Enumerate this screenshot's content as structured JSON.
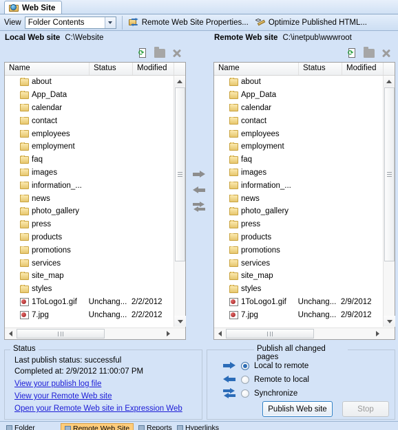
{
  "document_tab": {
    "label": "Web Site",
    "icon": "web-site-icon"
  },
  "toolbar": {
    "view_label": "View",
    "view_value": "Folder Contents",
    "remote_properties_label": "Remote Web Site Properties...",
    "optimize_label": "Optimize Published HTML..."
  },
  "local": {
    "title": "Local Web site",
    "path": "C:\\Website",
    "tools": [
      "refresh-icon",
      "new-folder-icon",
      "delete-icon"
    ],
    "columns": [
      "Name",
      "Status",
      "Modified"
    ],
    "rows": [
      {
        "name": "about",
        "icon": "folder-icon",
        "status": "",
        "modified": ""
      },
      {
        "name": "App_Data",
        "icon": "folder-icon",
        "status": "",
        "modified": ""
      },
      {
        "name": "calendar",
        "icon": "folder-icon",
        "status": "",
        "modified": ""
      },
      {
        "name": "contact",
        "icon": "folder-icon",
        "status": "",
        "modified": ""
      },
      {
        "name": "employees",
        "icon": "folder-icon",
        "status": "",
        "modified": ""
      },
      {
        "name": "employment",
        "icon": "folder-icon",
        "status": "",
        "modified": ""
      },
      {
        "name": "faq",
        "icon": "folder-icon",
        "status": "",
        "modified": ""
      },
      {
        "name": "images",
        "icon": "folder-icon",
        "status": "",
        "modified": ""
      },
      {
        "name": "information_...",
        "icon": "folder-icon",
        "status": "",
        "modified": ""
      },
      {
        "name": "news",
        "icon": "folder-icon",
        "status": "",
        "modified": ""
      },
      {
        "name": "photo_gallery",
        "icon": "folder-icon",
        "status": "",
        "modified": ""
      },
      {
        "name": "press",
        "icon": "folder-icon",
        "status": "",
        "modified": ""
      },
      {
        "name": "products",
        "icon": "folder-icon",
        "status": "",
        "modified": ""
      },
      {
        "name": "promotions",
        "icon": "folder-icon",
        "status": "",
        "modified": ""
      },
      {
        "name": "services",
        "icon": "folder-icon",
        "status": "",
        "modified": ""
      },
      {
        "name": "site_map",
        "icon": "folder-icon",
        "status": "",
        "modified": ""
      },
      {
        "name": "styles",
        "icon": "folder-icon",
        "status": "",
        "modified": ""
      },
      {
        "name": "1ToLogo1.gif",
        "icon": "image-file-icon",
        "status": "Unchang...",
        "modified": "2/2/2012"
      },
      {
        "name": "7.jpg",
        "icon": "image-file-icon",
        "status": "Unchang...",
        "modified": "2/2/2012"
      }
    ]
  },
  "remote": {
    "title": "Remote Web site",
    "path": "C:\\inetpub\\wwwroot",
    "tools": [
      "refresh-icon",
      "new-folder-icon",
      "delete-icon"
    ],
    "columns": [
      "Name",
      "Status",
      "Modified"
    ],
    "rows": [
      {
        "name": "about",
        "icon": "folder-icon",
        "status": "",
        "modified": ""
      },
      {
        "name": "App_Data",
        "icon": "folder-icon",
        "status": "",
        "modified": ""
      },
      {
        "name": "calendar",
        "icon": "folder-icon",
        "status": "",
        "modified": ""
      },
      {
        "name": "contact",
        "icon": "folder-icon",
        "status": "",
        "modified": ""
      },
      {
        "name": "employees",
        "icon": "folder-icon",
        "status": "",
        "modified": ""
      },
      {
        "name": "employment",
        "icon": "folder-icon",
        "status": "",
        "modified": ""
      },
      {
        "name": "faq",
        "icon": "folder-icon",
        "status": "",
        "modified": ""
      },
      {
        "name": "images",
        "icon": "folder-icon",
        "status": "",
        "modified": ""
      },
      {
        "name": "information_...",
        "icon": "folder-icon",
        "status": "",
        "modified": ""
      },
      {
        "name": "news",
        "icon": "folder-icon",
        "status": "",
        "modified": ""
      },
      {
        "name": "photo_gallery",
        "icon": "folder-icon",
        "status": "",
        "modified": ""
      },
      {
        "name": "press",
        "icon": "folder-icon",
        "status": "",
        "modified": ""
      },
      {
        "name": "products",
        "icon": "folder-icon",
        "status": "",
        "modified": ""
      },
      {
        "name": "promotions",
        "icon": "folder-icon",
        "status": "",
        "modified": ""
      },
      {
        "name": "services",
        "icon": "folder-icon",
        "status": "",
        "modified": ""
      },
      {
        "name": "site_map",
        "icon": "folder-icon",
        "status": "",
        "modified": ""
      },
      {
        "name": "styles",
        "icon": "folder-icon",
        "status": "",
        "modified": ""
      },
      {
        "name": "1ToLogo1.gif",
        "icon": "image-file-icon",
        "status": "Unchang...",
        "modified": "2/9/2012"
      },
      {
        "name": "7.jpg",
        "icon": "image-file-icon",
        "status": "Unchang...",
        "modified": "2/9/2012"
      }
    ]
  },
  "transfer_arrows": [
    "arrow-right-icon",
    "arrow-left-icon",
    "sync-arrows-icon"
  ],
  "status": {
    "caption": "Status",
    "last_publish": "Last publish status: successful",
    "completed_at": "Completed at: 2/9/2012 11:00:07 PM",
    "links": [
      "View your publish log file",
      "View your Remote Web site",
      "Open your Remote Web site in Expression Web"
    ]
  },
  "publish": {
    "caption": "Publish all changed pages",
    "options": [
      {
        "label": "Local to remote",
        "selected": true,
        "icon": "arrow-right-icon"
      },
      {
        "label": "Remote to local",
        "selected": false,
        "icon": "arrow-left-icon"
      },
      {
        "label": "Synchronize",
        "selected": false,
        "icon": "sync-arrows-icon"
      }
    ],
    "publish_button": "Publish Web site",
    "stop_button": "Stop"
  },
  "view_tabs": [
    {
      "label": "Folder",
      "selected": false
    },
    {
      "label": "Remote Web Site",
      "selected": true
    },
    {
      "label": "Reports",
      "selected": false
    },
    {
      "label": "Hyperlinks",
      "selected": false
    }
  ],
  "colors": {
    "chrome": "#d4e3f7",
    "accent": "#2b6cb8",
    "link": "#1a1ad6",
    "selected_tab": "#ffcc7a"
  }
}
